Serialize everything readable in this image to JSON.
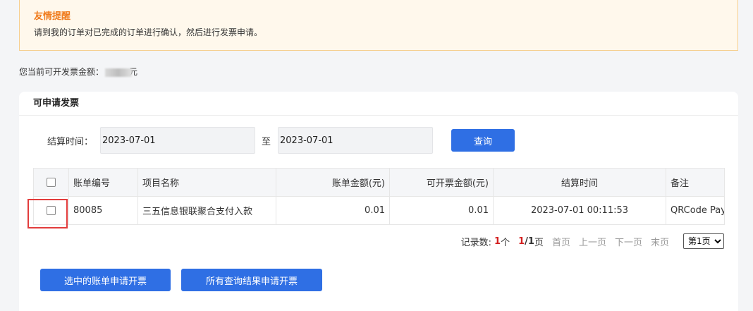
{
  "notice": {
    "title": "友情提醒",
    "text": "请到我的订单对已完成的订单进行确认，然后进行发票申请。"
  },
  "amount": {
    "label": "您当前可开发票金额：",
    "unit": "元"
  },
  "panel": {
    "title": "可申请发票"
  },
  "filter": {
    "label": "结算时间：",
    "start_date": "2023-07-01",
    "to_text": "至",
    "end_date": "2023-07-01",
    "query_label": "查询"
  },
  "table": {
    "headers": [
      "账单编号",
      "项目名称",
      "账单金额(元)",
      "可开票金额(元)",
      "结算时间",
      "备注"
    ],
    "rows": [
      {
        "bill_no": "80085",
        "project": "三五信息银联聚合支付入款",
        "amount": "0.01",
        "invoiceable": "0.01",
        "settle_time": "2023-07-01 00:11:53",
        "note": "QRCode Pay"
      }
    ]
  },
  "pager": {
    "records_label": "记录数:",
    "records_count": "1",
    "records_unit": "个",
    "current_page": "1",
    "total_pages": "/1",
    "pages_unit": "页",
    "first": "首页",
    "prev": "上一页",
    "next": "下一页",
    "last": "末页",
    "page_select_value": "第1页"
  },
  "actions": {
    "apply_selected": "选中的账单申请开票",
    "apply_all": "所有查询结果申请开票"
  },
  "colors": {
    "primary": "#2f6fe4",
    "notice_title": "#f07c1e",
    "highlight": "#e23c3c"
  }
}
